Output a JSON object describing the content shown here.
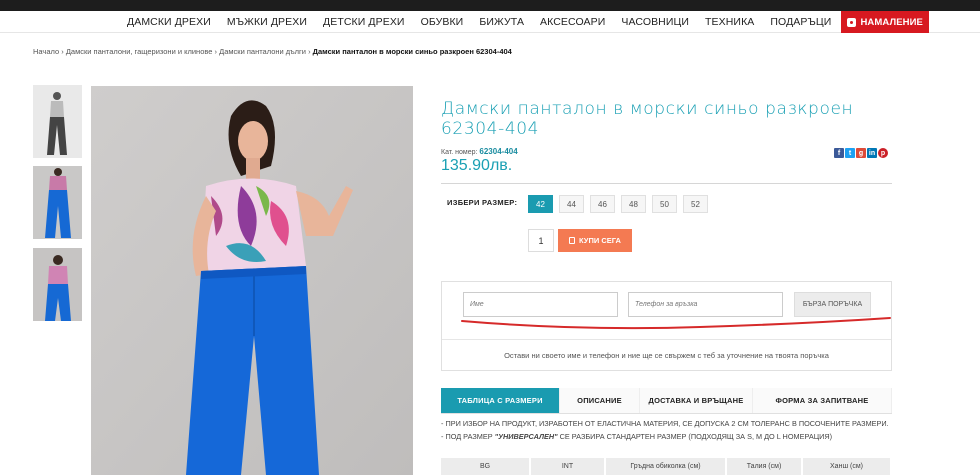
{
  "nav": {
    "items": [
      "ДАМСКИ ДРЕХИ",
      "МЪЖКИ ДРЕХИ",
      "ДЕТСКИ ДРЕХИ",
      "ОБУВКИ",
      "БИЖУТА",
      "АКСЕСОАРИ",
      "ЧАСОВНИЦИ",
      "ТЕХНИКА",
      "ПОДАРЪЦИ"
    ],
    "sale": "НАМАЛЕНИЕ"
  },
  "breadcrumb": {
    "home": "Начало",
    "level1": "Дамски панталони, гащеризони и клинове",
    "level2": "Дамски панталони дълги",
    "current": "Дамски панталон в морски синьо разкроен 62304-404",
    "sep": " › "
  },
  "product": {
    "title": "Дамски панталон в морски синьо разкроен 62304-404",
    "cat_label": "Кат. номер:",
    "cat_number": "62304-404",
    "price": "135.90лв.",
    "size_label": "ИЗБЕРИ РАЗМЕР:",
    "sizes": [
      "42",
      "44",
      "46",
      "48",
      "50",
      "52"
    ],
    "quantity": "1",
    "buy_label": "КУПИ СЕГА"
  },
  "share": {
    "icons": [
      "facebook-icon",
      "twitter-icon",
      "google-plus-icon",
      "linkedin-icon",
      "pinterest-icon"
    ],
    "glyphs": [
      "f",
      "t",
      "g",
      "in",
      "p"
    ],
    "colors": [
      "#3b5998",
      "#1da1f2",
      "#dd4b39",
      "#0077b5",
      "#cb2027"
    ]
  },
  "quick_order": {
    "name_placeholder": "Име",
    "phone_placeholder": "Телефон за връзка",
    "button": "БЪРЗА ПОРЪЧКА",
    "note": "Остави ни своето име и телефон и ние ще се свържем с теб за уточнение на твоята поръчка"
  },
  "tabs": [
    "ТАБЛИЦА С РАЗМЕРИ",
    "ОПИСАНИЕ",
    "ДОСТАВКА И ВРЪЩАНЕ",
    "ФОРМА ЗА ЗАПИТВАНЕ"
  ],
  "size_info": {
    "rule1": "- ПРИ ИЗБОР НА ПРОДУКТ, ИЗРАБОТЕН ОТ ЕЛАСТИЧНА МАТЕРИЯ, СЕ ДОПУСКА 2 СМ ТОЛЕРАНС В ПОСОЧЕНИТЕ РАЗМЕРИ.",
    "rule2_pre": "- ПОД РАЗМЕР ",
    "rule2_bold": "\"УНИВЕРСАЛЕН\"",
    "rule2_post": " СЕ РАЗБИРА СТАНДАРТЕН РАЗМЕР (ПОДХОДЯЩ ЗА S, M ДО L НОМЕРАЦИЯ)",
    "columns": [
      "BG",
      "INT",
      "Гръдна обиколка (см)",
      "Талия (см)",
      "Ханш (см)"
    ]
  },
  "colors": {
    "accent": "#1a9bb0",
    "buy": "#f47a52",
    "sale": "#d71920"
  }
}
